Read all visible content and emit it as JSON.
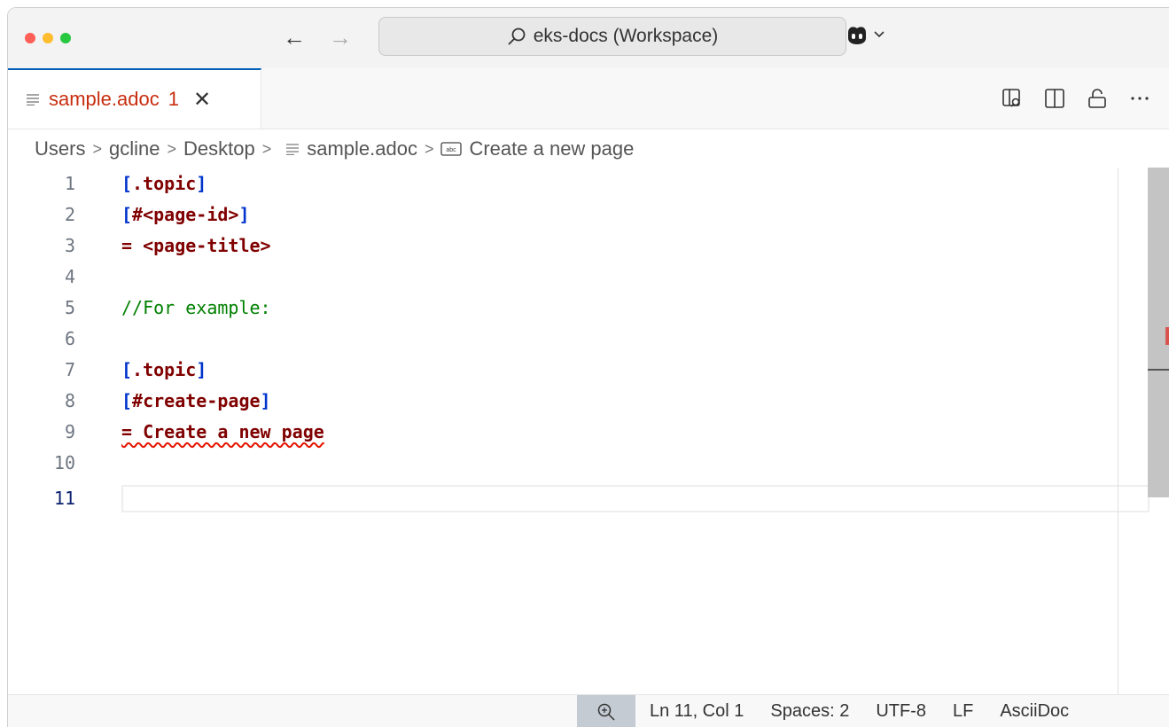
{
  "window": {
    "search_text": "eks-docs (Workspace)"
  },
  "tab": {
    "name": "sample.adoc",
    "problem_count": "1",
    "close_glyph": "✕"
  },
  "breadcrumb": {
    "items": [
      "Users",
      "gcline",
      "Desktop",
      "sample.adoc",
      "Create a new page"
    ]
  },
  "editor": {
    "lines": [
      {
        "number": "1",
        "text": "[.topic]"
      },
      {
        "number": "2",
        "text_open": "[",
        "text_mid": "#<page-id>",
        "text_close": "]"
      },
      {
        "number": "3",
        "text": "= <page-title>"
      },
      {
        "number": "4",
        "text": ""
      },
      {
        "number": "5",
        "text": "//For example:"
      },
      {
        "number": "6",
        "text": ""
      },
      {
        "number": "7",
        "text": "[.topic]"
      },
      {
        "number": "8",
        "text_open": "[",
        "text_mid": "#create-page",
        "text_close": "]"
      },
      {
        "number": "9",
        "text": "= Create a new page"
      },
      {
        "number": "10",
        "text": ""
      },
      {
        "number": "11",
        "text": ""
      }
    ],
    "line1_open": "[",
    "line1_mid": ".topic",
    "line1_close": "]"
  },
  "statusbar": {
    "position": "Ln 11, Col 1",
    "spaces": "Spaces: 2",
    "encoding": "UTF-8",
    "eol": "LF",
    "language": "AsciiDoc"
  },
  "colors": {
    "accent": "#005fb8",
    "error": "#c72e0f",
    "syntax_bracket": "#0033cc",
    "syntax_markup": "#800000",
    "syntax_comment": "#008000"
  }
}
